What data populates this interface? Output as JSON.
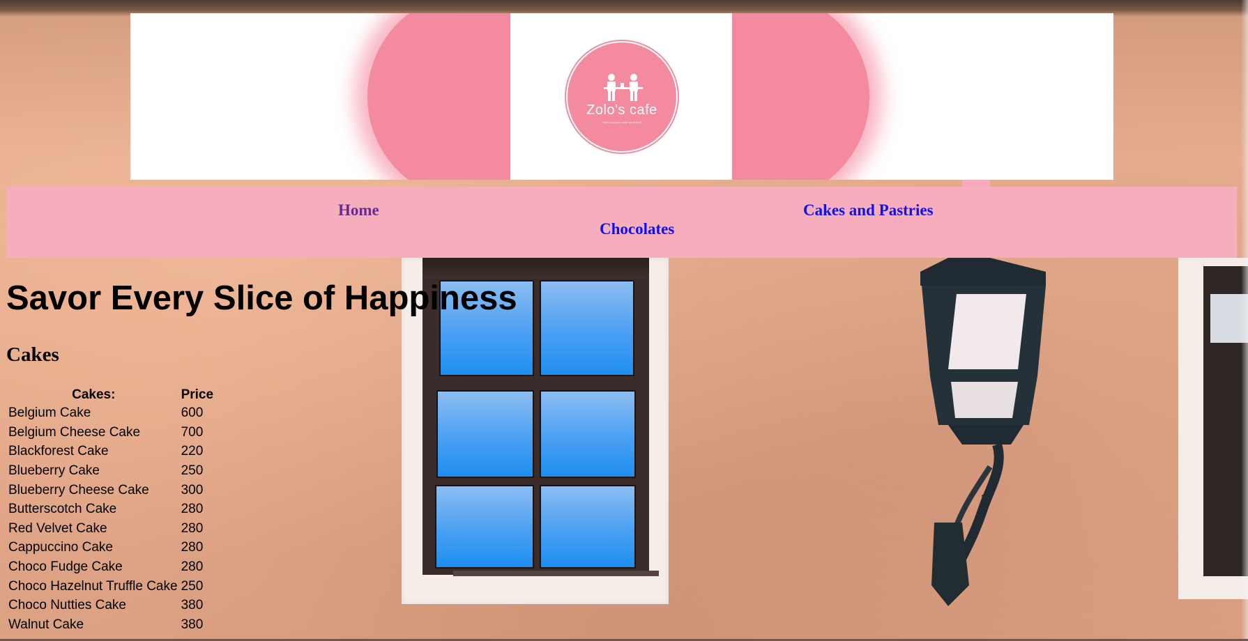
{
  "banner": {
    "logo_name": "Zolo's cafe",
    "logo_tagline": "Taste you love, smile you'll find!"
  },
  "nav": {
    "home": "Home",
    "cakes_and_pastries": "Cakes and Pastries",
    "chocolates": "Chocolates"
  },
  "hero": {
    "title": "Savor Every Slice of Happiness"
  },
  "cakes_section": {
    "title": "Cakes",
    "headers": [
      "Cakes:",
      "Price"
    ],
    "rows": [
      {
        "name": "Belgium Cake",
        "price": "600"
      },
      {
        "name": "Belgium Cheese Cake",
        "price": "700"
      },
      {
        "name": "Blackforest Cake",
        "price": "220"
      },
      {
        "name": "Blueberry Cake",
        "price": "250"
      },
      {
        "name": "Blueberry Cheese Cake",
        "price": "300"
      },
      {
        "name": "Butterscotch Cake",
        "price": "280"
      },
      {
        "name": "Red Velvet Cake",
        "price": "280"
      },
      {
        "name": "Cappuccino Cake",
        "price": "280"
      },
      {
        "name": "Choco Fudge Cake",
        "price": "280"
      },
      {
        "name": "Choco Hazelnut Truffle Cake",
        "price": "250"
      },
      {
        "name": "Choco Nutties Cake",
        "price": "380"
      },
      {
        "name": "Walnut Cake",
        "price": "380"
      }
    ]
  },
  "colors": {
    "nav_background": "#f6adbc",
    "logo_pink": "#f48aa0",
    "visited_link": "#662c91",
    "link": "#1010ee"
  }
}
